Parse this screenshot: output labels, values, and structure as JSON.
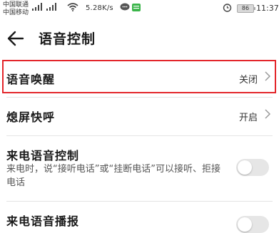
{
  "status_bar": {
    "carrier_1": "中国联通",
    "carrier_2": "中国移动",
    "network_speed": "5.28K/s",
    "battery_level": "86",
    "time": "11:37"
  },
  "header": {
    "title": "语音控制",
    "back_icon": "arrow-left-icon"
  },
  "settings": {
    "voice_wakeup": {
      "label": "语音唤醒",
      "value": "关闭"
    },
    "screen_off_quick_call": {
      "label": "熄屏快呼",
      "value": "开启"
    },
    "incoming_call_voice_control": {
      "label": "来电语音控制",
      "description": "来电时，说“接听电话”或“挂断电话”可以接听、拒接电话",
      "enabled": false
    },
    "incoming_call_voice_broadcast": {
      "label": "来电语音播报",
      "enabled": false
    }
  },
  "colors": {
    "highlight": "#e3262b",
    "toggle_off": "#e6e6e6"
  }
}
